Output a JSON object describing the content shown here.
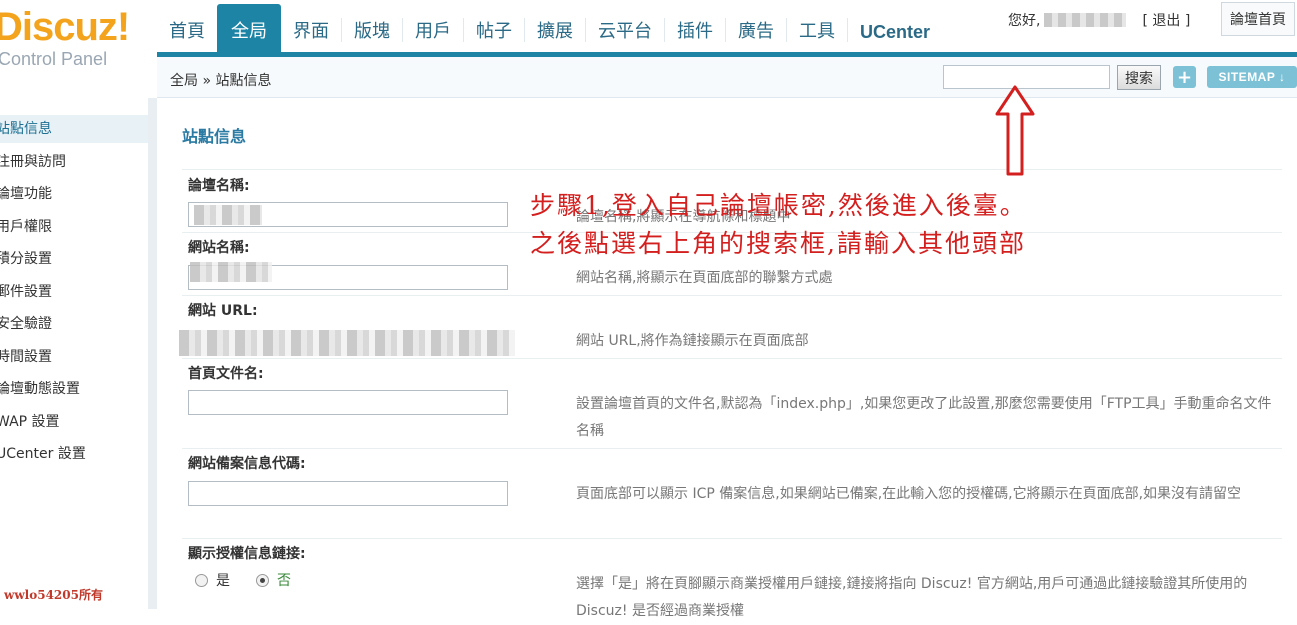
{
  "logo": {
    "brand": "Discuz!",
    "sub": "Control Panel"
  },
  "nav": {
    "tabs": [
      "首頁",
      "全局",
      "界面",
      "版塊",
      "用戶",
      "帖子",
      "擴展",
      "云平台",
      "插件",
      "廣告",
      "工具",
      "UCenter"
    ],
    "active": "全局"
  },
  "user": {
    "greeting": "您好,",
    "logout": "[ 退出 ]",
    "home": "論壇首頁"
  },
  "subbar": {
    "breadcrumb": "全局 » 站點信息",
    "search_button": "搜索",
    "plus": "+",
    "sitemap": "SITEMAP ↓"
  },
  "sidebar": {
    "items": [
      "站點信息",
      "注冊與訪問",
      "論壇功能",
      "用戶權限",
      "積分設置",
      "郵件設置",
      "安全驗證",
      "時間設置",
      "論壇動態設置",
      "WAP 設置",
      "UCenter 設置"
    ],
    "active_index": 0
  },
  "watermark": "wwlo54205所有",
  "main": {
    "title": "站點信息",
    "fields": [
      {
        "label": "論壇名稱:",
        "desc": "論壇名稱,將顯示在導航條和標題中"
      },
      {
        "label": "網站名稱:",
        "desc": "網站名稱,將顯示在頁面底部的聯繫方式處"
      },
      {
        "label": "網站 URL:",
        "desc": "網站 URL,將作為鏈接顯示在頁面底部"
      },
      {
        "label": "首頁文件名:",
        "desc": "設置論壇首頁的文件名,默認為「index.php」,如果您更改了此設置,那麼您需要使用「FTP工具」手動重命名文件名稱"
      },
      {
        "label": "網站備案信息代碼:",
        "desc": "頁面底部可以顯示 ICP 備案信息,如果網站已備案,在此輸入您的授權碼,它將顯示在頁面底部,如果沒有請留空"
      },
      {
        "label": "顯示授權信息鏈接:",
        "desc": "選擇「是」將在頁腳顯示商業授權用戶鏈接,鏈接將指向 Discuz! 官方網站,用戶可通過此鏈接驗證其所使用的 Discuz! 是否經過商業授權"
      }
    ],
    "radio": {
      "yes": "是",
      "no": "否",
      "selected": "否"
    }
  },
  "annotation": {
    "line1": "步驟1,登入自己論壇帳密,然後進入後臺。",
    "line2": "之後點選右上角的搜索框,請輸入其他頭部"
  },
  "colors": {
    "accent": "#1e84a6",
    "annotation": "#d41f1f",
    "logo": "#f3a31c"
  }
}
